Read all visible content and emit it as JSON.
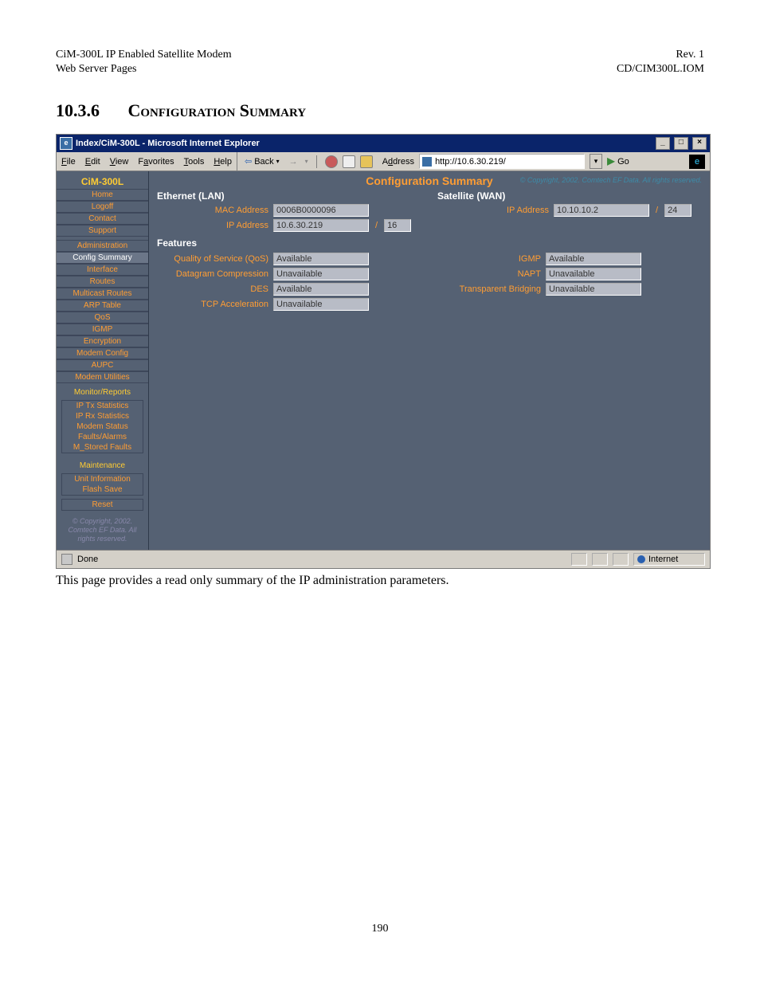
{
  "doc": {
    "hl1": "CiM-300L IP Enabled Satellite Modem",
    "hl2": "Web Server Pages",
    "hr1": "Rev. 1",
    "hr2": "CD/CIM300L.IOM",
    "section_num": "10.3.6",
    "section_title": "Configuration Summary",
    "body": "This page provides a read only summary of the IP administration parameters.",
    "page_number": "190"
  },
  "window": {
    "title": "Index/CiM-300L - Microsoft Internet Explorer",
    "menus": {
      "file": "File",
      "edit": "Edit",
      "view": "View",
      "favorites": "Favorites",
      "tools": "Tools",
      "help": "Help"
    },
    "toolbar": {
      "back": "Back"
    },
    "address_label": "Address",
    "address": "http://10.6.30.219/",
    "go": "Go",
    "status_done": "Done",
    "status_zone": "Internet"
  },
  "sidebar": {
    "product": "CiM-300L",
    "items1": [
      "Home",
      "Logoff",
      "Contact",
      "Support"
    ],
    "admin": "Administration",
    "config_summary": "Config Summary",
    "items2": [
      "Interface",
      "Routes",
      "Multicast Routes",
      "ARP Table",
      "QoS",
      "IGMP",
      "Encryption",
      "Modem Config",
      "AUPC",
      "Modem Utilities"
    ],
    "monitor": "Monitor/Reports",
    "monitor_items": [
      "IP Tx Statistics",
      "IP Rx Statistics",
      "Modem Status",
      "Faults/Alarms",
      "M_Stored Faults"
    ],
    "maintenance": "Maintenance",
    "maint_items": [
      "Unit Information",
      "Flash Save"
    ],
    "reset": "Reset",
    "copyright": "© Copyright, 2002. Comtech EF Data. All rights reserved."
  },
  "summary": {
    "title": "Configuration Summary",
    "copy": "© Copyright, 2002. Comtech EF Data. All rights reserved.",
    "lan_title": "Ethernet (LAN)",
    "wan_title": "Satellite (WAN)",
    "mac_label": "MAC Address",
    "mac_value": "0006B0000096",
    "lan_ip_label": "IP Address",
    "lan_ip_value": "10.6.30.219",
    "lan_prefix": "16",
    "wan_ip_label": "IP Address",
    "wan_ip_value": "10.10.10.2",
    "wan_prefix": "24",
    "features_title": "Features",
    "qos_label": "Quality of Service (QoS)",
    "qos_value": "Available",
    "dc_label": "Datagram Compression",
    "dc_value": "Unavailable",
    "des_label": "DES",
    "des_value": "Available",
    "tcp_label": "TCP Acceleration",
    "tcp_value": "Unavailable",
    "igmp_label": "IGMP",
    "igmp_value": "Available",
    "napt_label": "NAPT",
    "napt_value": "Unavailable",
    "tb_label": "Transparent Bridging",
    "tb_value": "Unavailable"
  }
}
